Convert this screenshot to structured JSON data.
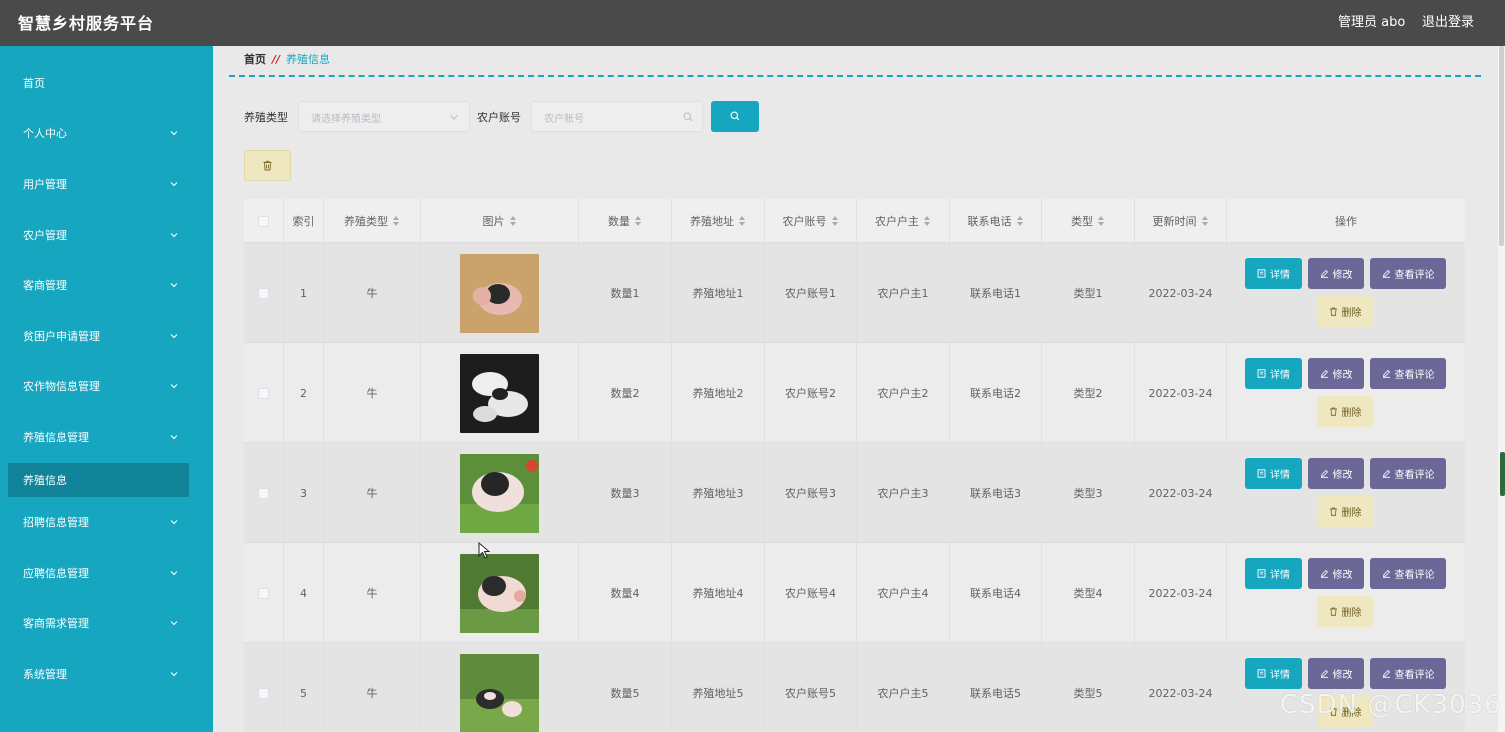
{
  "header": {
    "brand": "智慧乡村服务平台",
    "user": "管理员 abo",
    "logout": "退出登录"
  },
  "sidebar": {
    "items": [
      {
        "label": "首页",
        "has_children": false
      },
      {
        "label": "个人中心",
        "has_children": true
      },
      {
        "label": "用户管理",
        "has_children": true
      },
      {
        "label": "农户管理",
        "has_children": true
      },
      {
        "label": "客商管理",
        "has_children": true
      },
      {
        "label": "贫困户申请管理",
        "has_children": true
      },
      {
        "label": "农作物信息管理",
        "has_children": true
      },
      {
        "label": "养殖信息管理",
        "has_children": true
      },
      {
        "label": "养殖信息",
        "has_children": false,
        "active": true
      },
      {
        "label": "招聘信息管理",
        "has_children": true
      },
      {
        "label": "应聘信息管理",
        "has_children": true
      },
      {
        "label": "客商需求管理",
        "has_children": true
      },
      {
        "label": "系统管理",
        "has_children": true
      }
    ]
  },
  "breadcrumb": {
    "home": "首页",
    "separator": "//",
    "current": "养殖信息"
  },
  "filters": {
    "type_label": "养殖类型",
    "type_placeholder": "请选择养殖类型",
    "account_label": "农户账号",
    "account_placeholder": "农户账号"
  },
  "table": {
    "columns": [
      "索引",
      "养殖类型",
      "图片",
      "数量",
      "养殖地址",
      "农户账号",
      "农户户主",
      "联系电话",
      "类型",
      "更新时间",
      "操作"
    ],
    "rows": [
      {
        "index": "1",
        "breed_type": "牛",
        "image": "pig-photo",
        "quantity": "数量1",
        "address": "养殖地址1",
        "account": "农户账号1",
        "owner": "农户户主1",
        "phone": "联系电话1",
        "type": "类型1",
        "updated": "2022-03-24"
      },
      {
        "index": "2",
        "breed_type": "牛",
        "image": "pig-photo",
        "quantity": "数量2",
        "address": "养殖地址2",
        "account": "农户账号2",
        "owner": "农户户主2",
        "phone": "联系电话2",
        "type": "类型2",
        "updated": "2022-03-24"
      },
      {
        "index": "3",
        "breed_type": "牛",
        "image": "pig-photo",
        "quantity": "数量3",
        "address": "养殖地址3",
        "account": "农户账号3",
        "owner": "农户户主3",
        "phone": "联系电话3",
        "type": "类型3",
        "updated": "2022-03-24"
      },
      {
        "index": "4",
        "breed_type": "牛",
        "image": "pig-photo",
        "quantity": "数量4",
        "address": "养殖地址4",
        "account": "农户账号4",
        "owner": "农户户主4",
        "phone": "联系电话4",
        "type": "类型4",
        "updated": "2022-03-24"
      },
      {
        "index": "5",
        "breed_type": "牛",
        "image": "pig-photo",
        "quantity": "数量5",
        "address": "养殖地址5",
        "account": "农户账号5",
        "owner": "农户户主5",
        "phone": "联系电话5",
        "type": "类型5",
        "updated": "2022-03-24"
      }
    ],
    "actions": {
      "detail": "详情",
      "edit": "修改",
      "review": "查看评论",
      "delete": "删除"
    }
  },
  "watermark": "CSDN @CK3036",
  "colors": {
    "accent": "#17a6c0",
    "topbar": "#4a4a4a",
    "purple_button": "#6b6796",
    "delete_button": "#efe7bf"
  }
}
